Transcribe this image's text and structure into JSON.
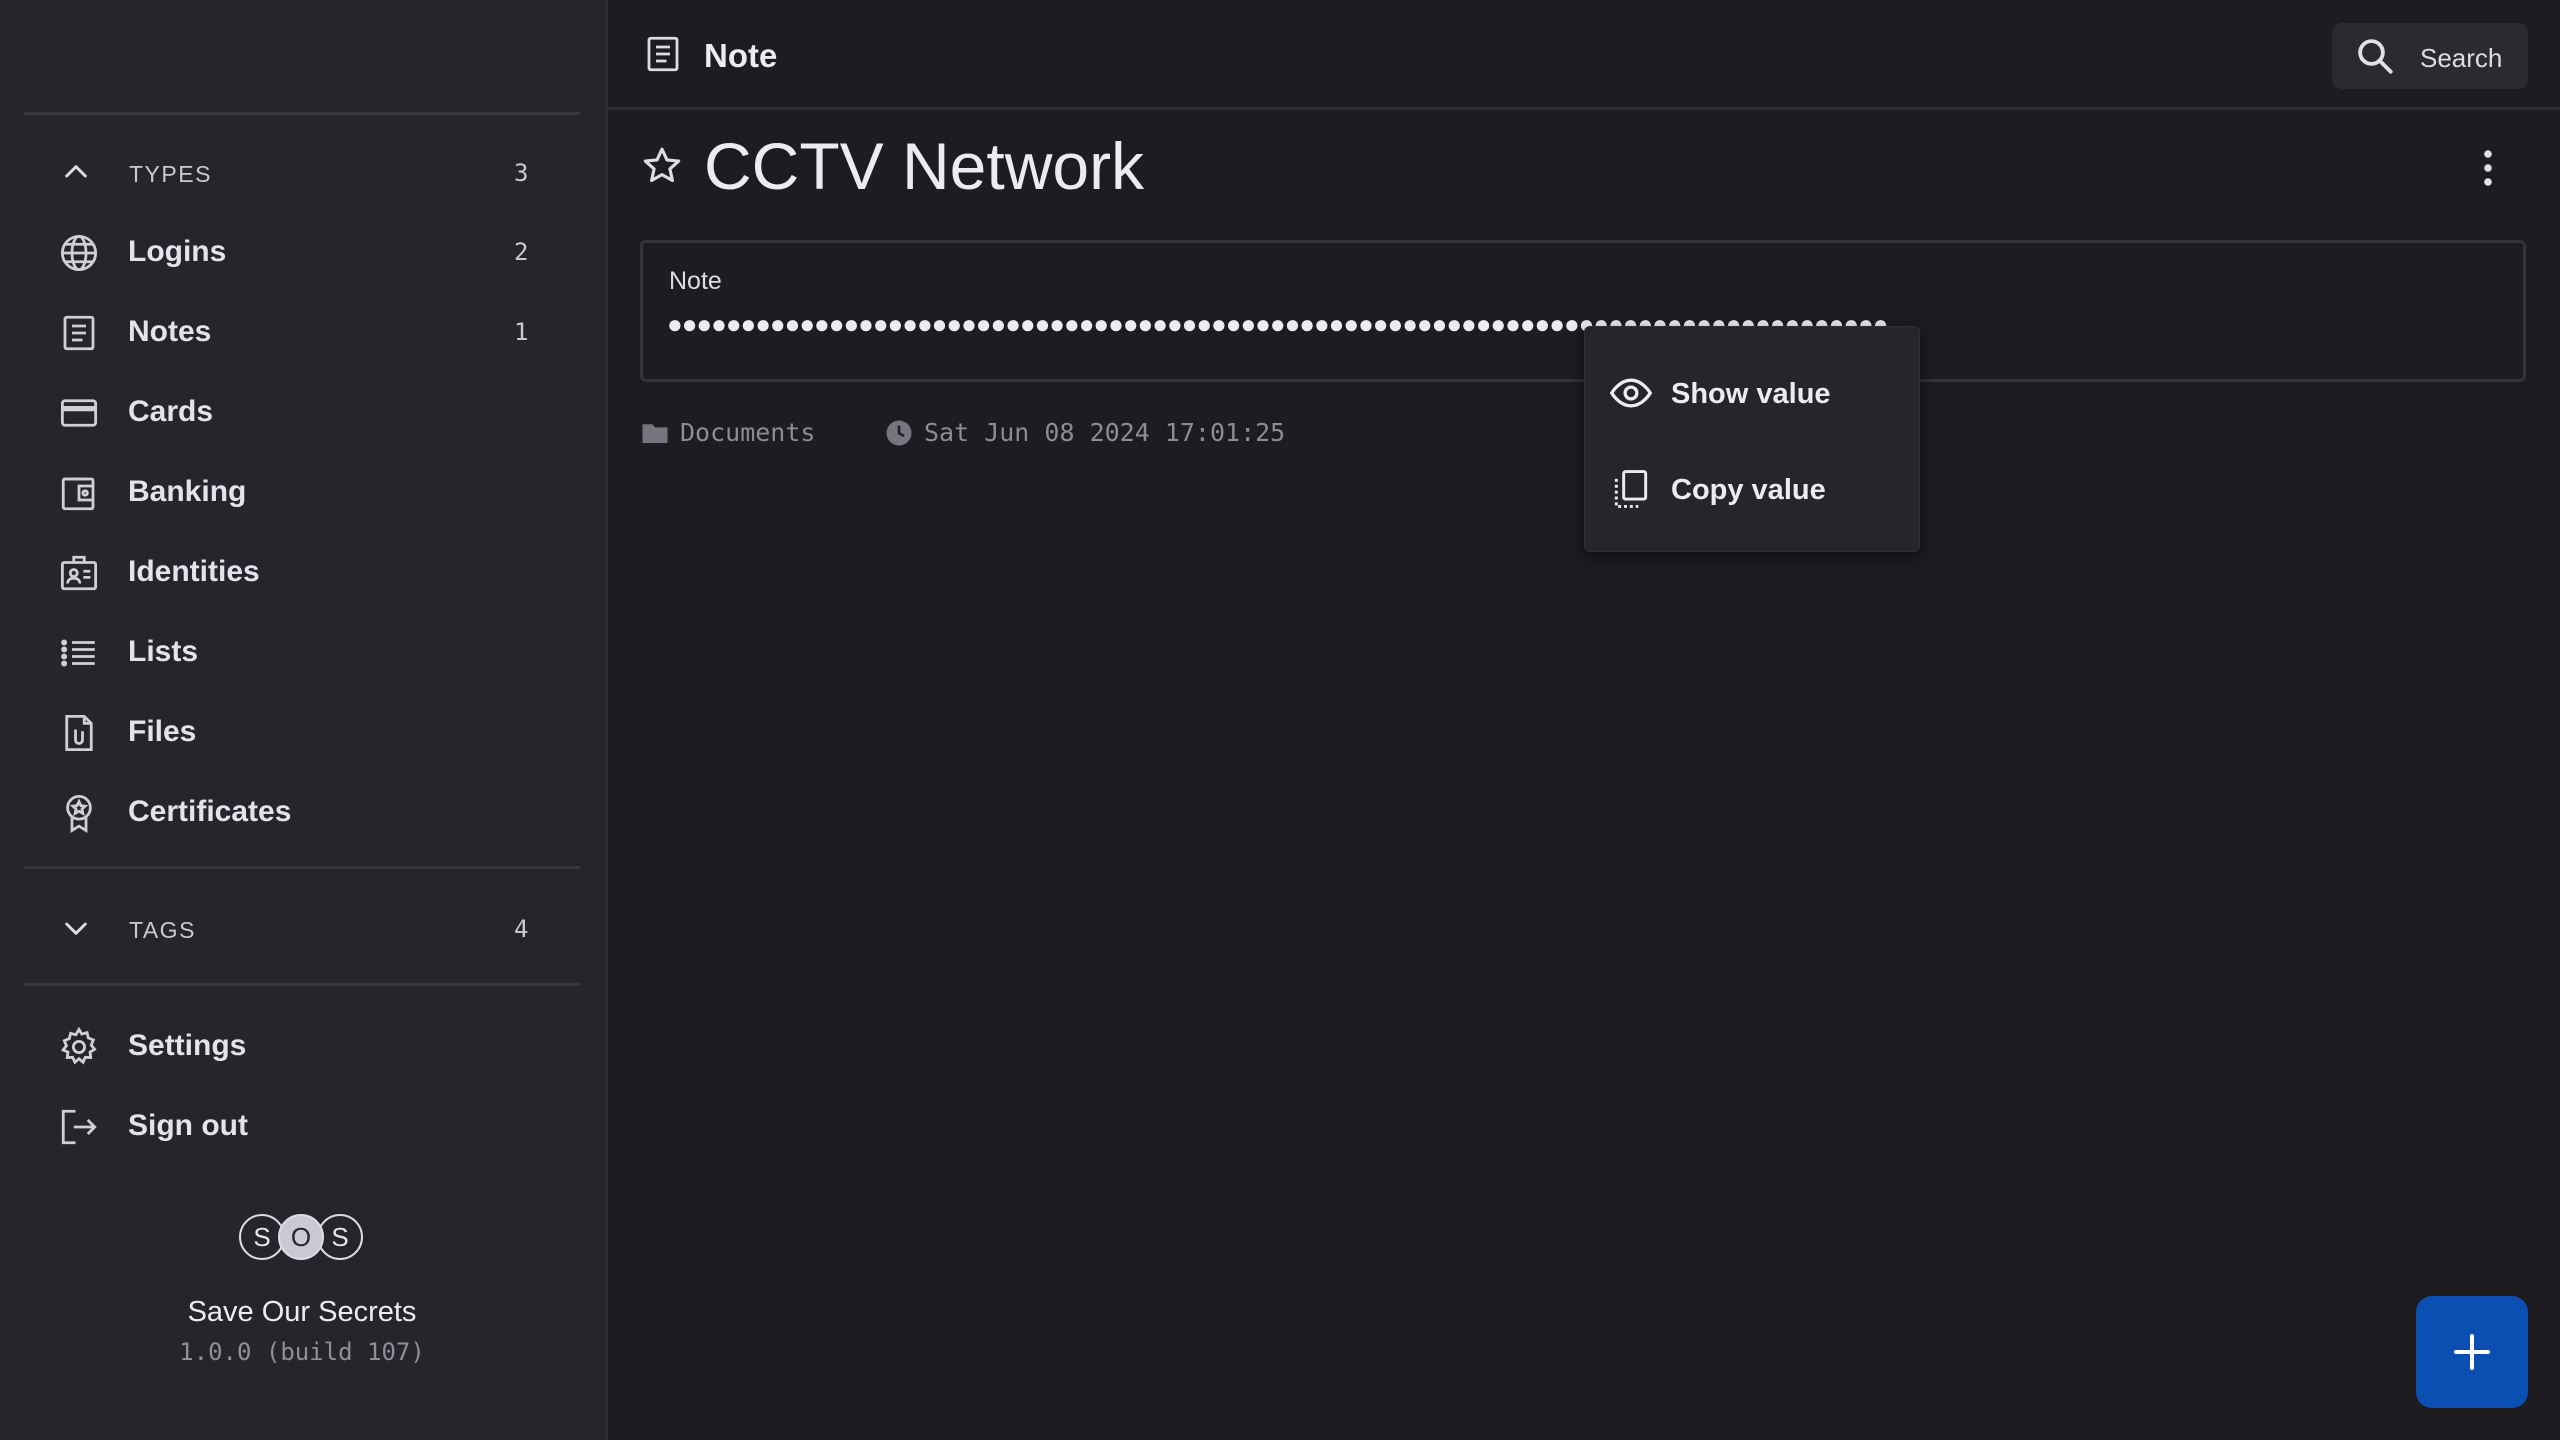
{
  "sidebar": {
    "types": {
      "label": "TYPES",
      "count": "3"
    },
    "items": [
      {
        "label": "Logins",
        "count": "2",
        "icon": "globe-icon"
      },
      {
        "label": "Notes",
        "count": "1",
        "icon": "note-icon"
      },
      {
        "label": "Cards",
        "count": "",
        "icon": "credit-card-icon"
      },
      {
        "label": "Banking",
        "count": "",
        "icon": "wallet-icon"
      },
      {
        "label": "Identities",
        "count": "",
        "icon": "id-badge-icon"
      },
      {
        "label": "Lists",
        "count": "",
        "icon": "list-icon"
      },
      {
        "label": "Files",
        "count": "",
        "icon": "file-attachment-icon"
      },
      {
        "label": "Certificates",
        "count": "",
        "icon": "certificate-icon"
      }
    ],
    "tags": {
      "label": "TAGS",
      "count": "4"
    },
    "settings_label": "Settings",
    "signout_label": "Sign out",
    "logo_letters": [
      "S",
      "O",
      "S"
    ],
    "app_name": "Save Our Secrets",
    "app_version": "1.0.0 (build 107)"
  },
  "header": {
    "title": "Note",
    "search_label": "Search"
  },
  "main": {
    "heading": "CCTV Network",
    "note_label": "Note",
    "note_value_masked": "●●●●●●●●●●●●●●●●●●●●●●●●●●●●●●●●●●●●●●●●●●●●●●●●●●●●●●●●●●●●●●●●●●●●●●●●●●●●●●●●●●●",
    "folder": "Documents",
    "timestamp": "Sat Jun 08 2024 17:01:25"
  },
  "context_menu": {
    "show_value": "Show value",
    "copy_value": "Copy value"
  },
  "colors": {
    "background": "#1c1c21",
    "sidebar": "#25262b",
    "accent": "#0b4fb3"
  }
}
